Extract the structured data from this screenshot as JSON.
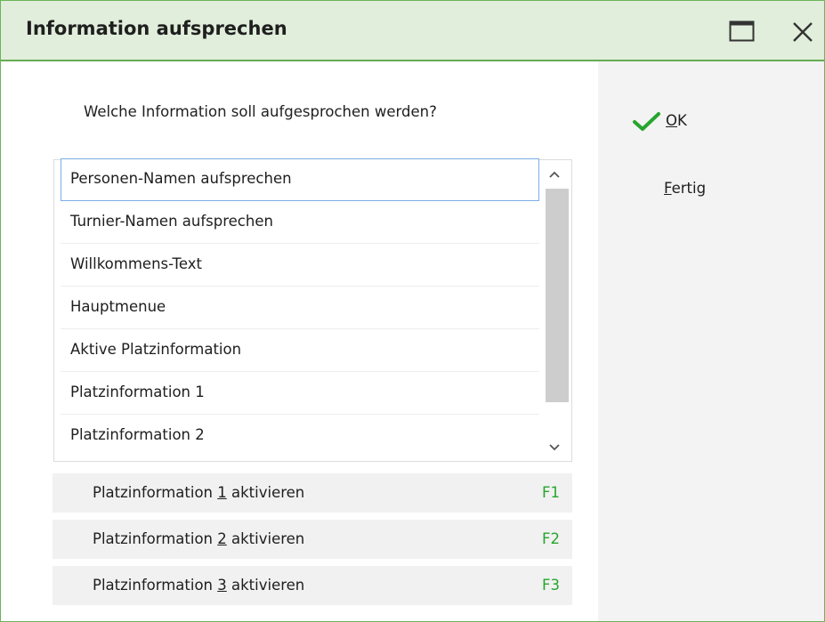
{
  "window": {
    "title": "Information aufsprechen"
  },
  "question": "Welche Information soll aufgesprochen werden?",
  "list": {
    "items": [
      {
        "label": "Personen-Namen aufsprechen"
      },
      {
        "label": "Turnier-Namen aufsprechen"
      },
      {
        "label": "Willkommens-Text"
      },
      {
        "label": "Hauptmenue"
      },
      {
        "label": "Aktive Platzinformation"
      },
      {
        "label": "Platzinformation 1"
      },
      {
        "label": "Platzinformation 2"
      }
    ]
  },
  "actions": [
    {
      "pre": "Platzinformation ",
      "num": "1",
      "post": " aktivieren",
      "key": "F1"
    },
    {
      "pre": "Platzinformation ",
      "num": "2",
      "post": " aktivieren",
      "key": "F2"
    },
    {
      "pre": "Platzinformation ",
      "num": "3",
      "post": " aktivieren",
      "key": "F3"
    }
  ],
  "buttons": {
    "ok": {
      "mnemonic": "O",
      "rest": "K"
    },
    "fertig": {
      "mnemonic": "F",
      "rest": "ertig"
    }
  },
  "colors": {
    "accent_green": "#26a52d",
    "title_bg": "#e0eedb"
  },
  "icons": [
    "maximize-icon",
    "close-icon",
    "checkmark-icon",
    "scroll-up-icon",
    "scroll-down-icon"
  ]
}
